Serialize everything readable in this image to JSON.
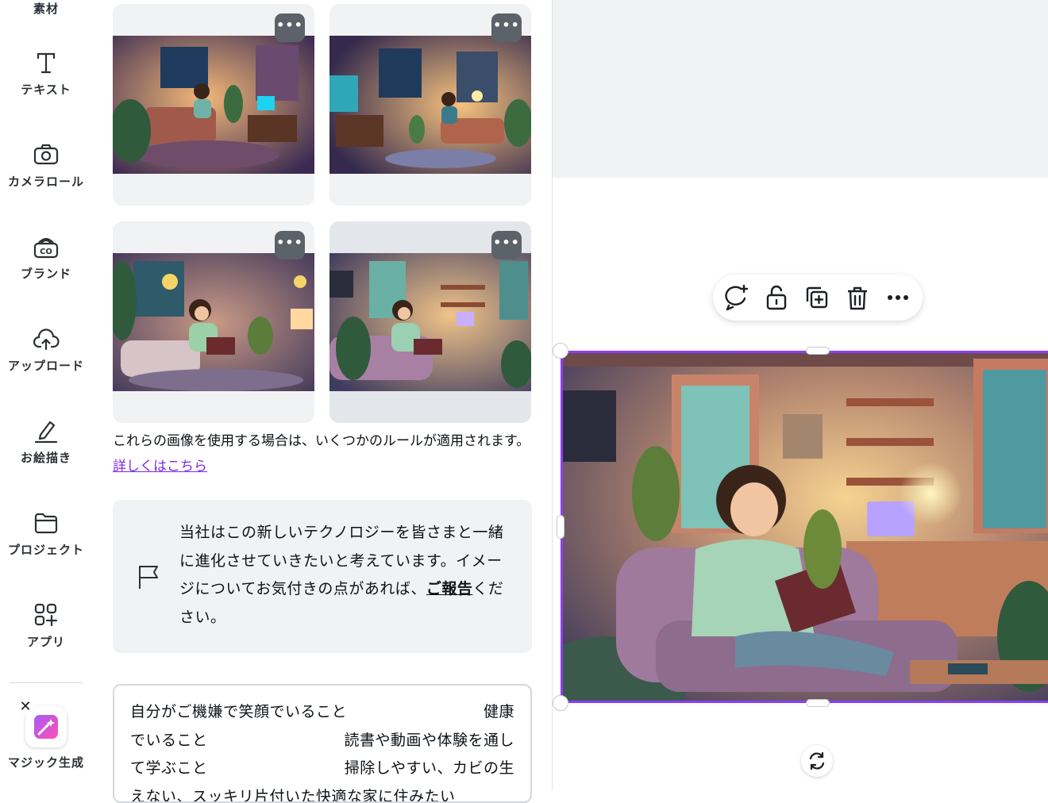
{
  "sidebar": {
    "top_label": "素材",
    "items": [
      {
        "label": "テキスト",
        "icon": "text-icon"
      },
      {
        "label": "カメラロール",
        "icon": "camera-icon"
      },
      {
        "label": "ブランド",
        "icon": "brand-icon"
      },
      {
        "label": "アップロード",
        "icon": "upload-cloud-icon"
      },
      {
        "label": "お絵描き",
        "icon": "draw-pen-icon"
      },
      {
        "label": "プロジェクト",
        "icon": "folder-icon"
      },
      {
        "label": "アプリ",
        "icon": "apps-grid-icon"
      }
    ],
    "magic": {
      "label": "マジック生成",
      "close": "✕",
      "icon": "magic-media-icon"
    }
  },
  "results": {
    "more_label": "•••",
    "rules_text": "これらの画像を使用する場合は、いくつかのルールが適用されます。",
    "rules_link": "詳しくはこちら"
  },
  "feedback": {
    "text_before": "当社はこの新しいテクノロジーを皆さまと一緒に進化させていきたいと考えています。イメージについてお気付きの点があれば、",
    "report_link": "ご報告",
    "text_after": "ください。"
  },
  "prompt": {
    "line1_a": "自分がご機嫌で笑顔でいること",
    "line1_b": "健康",
    "line2_a": "でいること",
    "line2_b": "読書や動画や体験を通し",
    "line3_a": "て学ぶこと",
    "line3_b": "掃除しやすい、カビの生",
    "line4": "えない、スッキリ片付いた快適な家に住みたい"
  },
  "colors": {
    "accent": "#8b3dff",
    "link": "#7d2ae8",
    "panel_bg": "#f1f2f4",
    "more_button": "#5c6269"
  }
}
